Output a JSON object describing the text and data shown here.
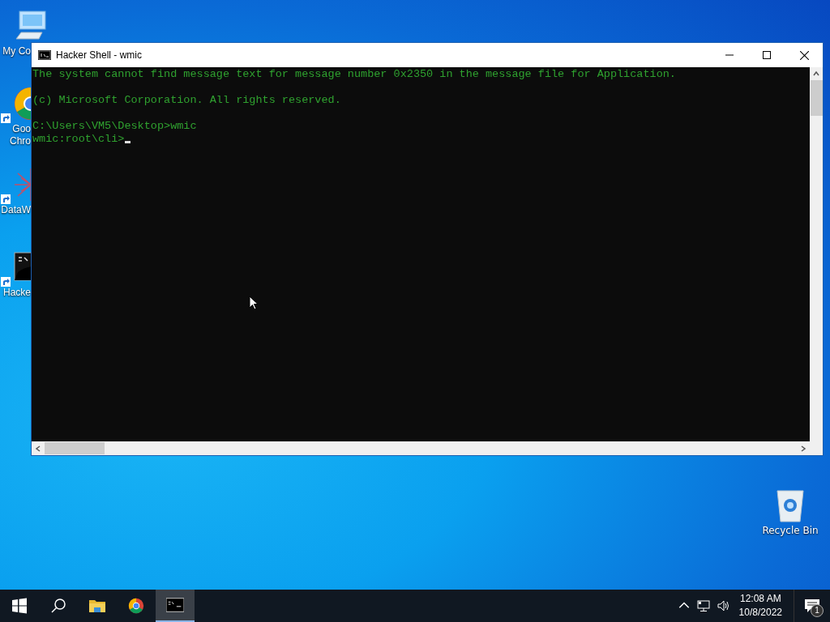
{
  "desktop_icons": [
    {
      "kind": "computer",
      "lines": [
        "My Co"
      ]
    },
    {
      "kind": "chrome",
      "lines": [
        "Goo",
        "Chro"
      ]
    },
    {
      "kind": "molecule",
      "lines": [
        "DataW"
      ]
    },
    {
      "kind": "console",
      "lines": [
        "Hacke"
      ]
    },
    {
      "kind": "recycle",
      "lines": [
        "Recycle Bin"
      ]
    }
  ],
  "window": {
    "title": "Hacker Shell - wmic",
    "console_blocks": [
      [
        "The system cannot find message text for message number 0x2350 in the message file for Application."
      ],
      [
        "(c) Microsoft Corporation. All rights reserved."
      ],
      [
        "C:\\Users\\VM5\\Desktop>wmic",
        "wmic:root\\cli>"
      ]
    ]
  },
  "taskbar": {
    "apps": [
      {
        "kind": "start",
        "selected": false
      },
      {
        "kind": "search",
        "selected": false
      },
      {
        "kind": "folder",
        "selected": false
      },
      {
        "kind": "chrome",
        "selected": false
      },
      {
        "kind": "console",
        "selected": true
      }
    ],
    "time": "12:08 AM",
    "date": "10/8/2022",
    "notification_count": "1"
  }
}
